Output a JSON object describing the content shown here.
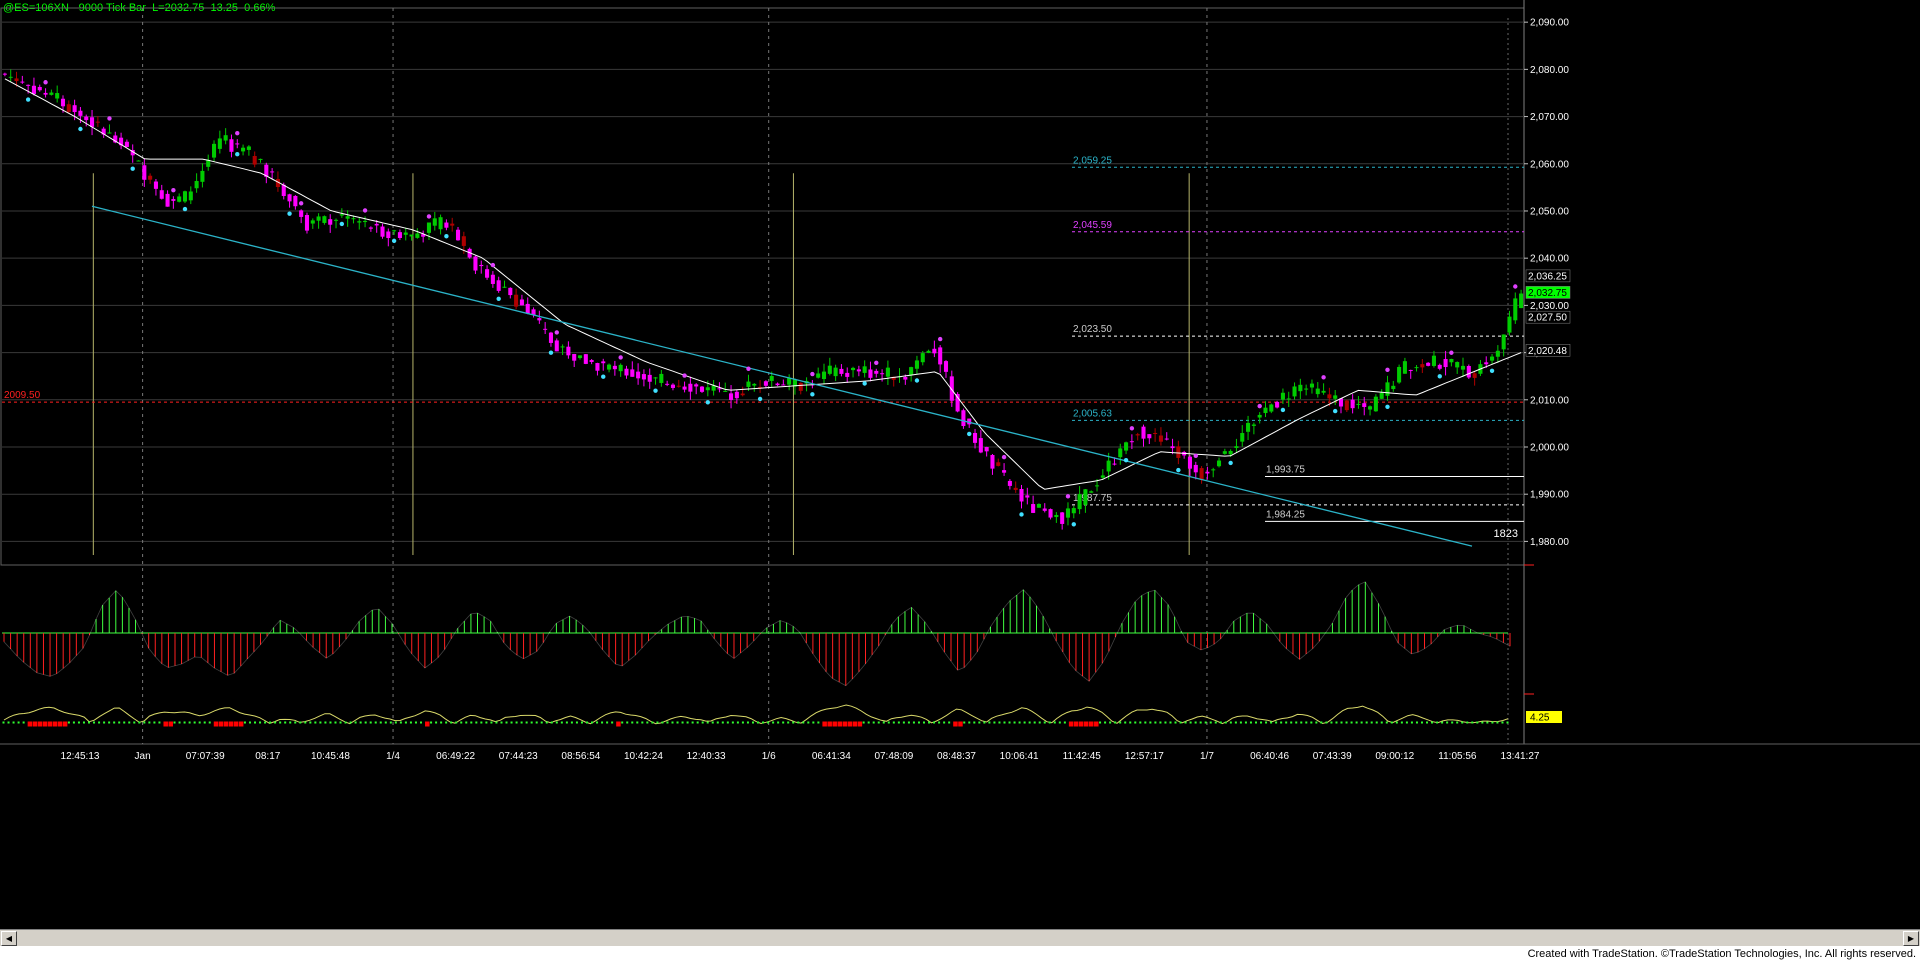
{
  "header": {
    "symbol": "@ES=106XN - 9000 Tick Bar",
    "last": "L=2032.75",
    "change": "13.25",
    "pct": "0.66%"
  },
  "footer_text": "Created with TradeStation. ©TradeStation Technologies, Inc. All rights reserved.",
  "colors": {
    "background": "#000000",
    "bull": "#00cc00",
    "bear": "#ff00ff",
    "bear_dark": "#b00000",
    "ma": "#ffffff",
    "trendline": "#2bb3c8",
    "cyan_dot": "#40e0ff",
    "magenta_dot": "#e040ff",
    "hist_up": "#40ff40",
    "hist_down": "#ff2020",
    "yellow": "#ffff00"
  },
  "chart_data": [
    {
      "type": "candlestick",
      "title": "@ES=106XN - 9000 Tick Bar",
      "ylim": [
        1975,
        2093
      ],
      "y_ticks": [
        "2,090.00",
        "2,080.00",
        "2,070.00",
        "2,060.00",
        "2,050.00",
        "2,040.00",
        "2,030.00",
        "2,020.00",
        "2,010.00",
        "2,000.00",
        "1,990.00",
        "1,980.00"
      ],
      "x_tick_labels": [
        "12:45:13",
        "Jan",
        "07:07:39",
        "08:17",
        "10:45:48",
        "1/4",
        "06:49:22",
        "07:44:23",
        "08:56:54",
        "10:42:24",
        "12:40:33",
        "1/6",
        "06:41:34",
        "07:48:09",
        "08:48:37",
        "10:06:41",
        "11:42:45",
        "12:57:17",
        "1/7",
        "06:40:46",
        "07:43:39",
        "09:00:12",
        "11:05:56",
        "13:41:27"
      ],
      "price_path": [
        [
          0,
          2079
        ],
        [
          10,
          2073
        ],
        [
          20,
          2064
        ],
        [
          28,
          2052
        ],
        [
          31,
          2053
        ],
        [
          37,
          2065
        ],
        [
          42,
          2062
        ],
        [
          48,
          2054
        ],
        [
          52,
          2047
        ],
        [
          58,
          2049
        ],
        [
          64,
          2046
        ],
        [
          70,
          2045
        ],
        [
          76,
          2048
        ],
        [
          81,
          2038
        ],
        [
          88,
          2031
        ],
        [
          94,
          2022
        ],
        [
          100,
          2018
        ],
        [
          106,
          2016
        ],
        [
          112,
          2014
        ],
        [
          118,
          2013
        ],
        [
          124,
          2011
        ],
        [
          130,
          2014
        ],
        [
          136,
          2013
        ],
        [
          142,
          2016
        ],
        [
          148,
          2016
        ],
        [
          154,
          2015
        ],
        [
          159,
          2022
        ],
        [
          164,
          2006
        ],
        [
          170,
          1995
        ],
        [
          176,
          1987
        ],
        [
          182,
          1985
        ],
        [
          188,
          1994
        ],
        [
          194,
          2004
        ],
        [
          200,
          2000
        ],
        [
          205,
          1994
        ],
        [
          210,
          2000
        ],
        [
          216,
          2008
        ],
        [
          222,
          2013
        ],
        [
          228,
          2010
        ],
        [
          234,
          2008
        ],
        [
          240,
          2017
        ],
        [
          246,
          2018
        ],
        [
          252,
          2016
        ],
        [
          256,
          2021
        ],
        [
          260,
          2033
        ]
      ],
      "moving_average": [
        [
          0,
          2078
        ],
        [
          12,
          2070
        ],
        [
          24,
          2061
        ],
        [
          34,
          2061
        ],
        [
          44,
          2058
        ],
        [
          56,
          2050
        ],
        [
          70,
          2046
        ],
        [
          82,
          2040
        ],
        [
          96,
          2026
        ],
        [
          110,
          2018
        ],
        [
          124,
          2012
        ],
        [
          136,
          2013
        ],
        [
          148,
          2014
        ],
        [
          160,
          2016
        ],
        [
          168,
          2003
        ],
        [
          178,
          1991
        ],
        [
          188,
          1993
        ],
        [
          198,
          1999
        ],
        [
          210,
          1998
        ],
        [
          222,
          2006
        ],
        [
          232,
          2012
        ],
        [
          242,
          2011
        ],
        [
          252,
          2016
        ],
        [
          260,
          2020
        ]
      ],
      "price_lines": [
        {
          "label": "2,059.25",
          "value": 2059.25,
          "color": "#2bb3c8",
          "style": "dash"
        },
        {
          "label": "2,045.59",
          "value": 2045.59,
          "color": "#e040ff",
          "style": "dash"
        },
        {
          "label": "2,023.50",
          "value": 2023.5,
          "color": "#ffffff",
          "style": "dash"
        },
        {
          "label": "2009.50",
          "value": 2009.5,
          "color": "#ff2020",
          "style": "dash"
        },
        {
          "label": "2,005.63",
          "value": 2005.63,
          "color": "#2bb3c8",
          "style": "dash"
        },
        {
          "label": "1,993.75",
          "value": 1993.75,
          "color": "#ffffff",
          "style": "solid"
        },
        {
          "label": "1,987.75",
          "value": 1987.75,
          "color": "#ffffff",
          "style": "dash"
        },
        {
          "label": "1,984.25",
          "value": 1984.25,
          "color": "#ffffff",
          "style": "solid"
        }
      ],
      "right_labels": [
        {
          "text": "2,036.25",
          "value": 2036.25,
          "bg": "#000000",
          "fg": "#ffffff",
          "box": true
        },
        {
          "text": "2,032.75",
          "value": 2032.75,
          "bg": "#00ff00",
          "fg": "#000000",
          "box": true
        },
        {
          "text": "2,027.50",
          "value": 2027.5,
          "bg": "#000000",
          "fg": "#ffffff",
          "box": true
        },
        {
          "text": "2,020.48",
          "value": 2020.48,
          "bg": "#000000",
          "fg": "#ffffff",
          "box": true
        }
      ],
      "annotation": "1823",
      "trendline": [
        [
          0,
          2051
        ],
        [
          270,
          1979
        ]
      ]
    },
    {
      "type": "histogram",
      "name": "oscillator",
      "values": [
        -2,
        -6,
        -9,
        -10,
        -7,
        -3,
        6,
        10,
        4,
        -4,
        -8,
        -7,
        -5,
        -8,
        -10,
        -6,
        -2,
        3,
        1,
        -3,
        -6,
        -2,
        3,
        6,
        2,
        -4,
        -8,
        -5,
        1,
        5,
        3,
        -3,
        -6,
        -4,
        2,
        4,
        1,
        -4,
        -8,
        -5,
        -1,
        2,
        4,
        3,
        -2,
        -6,
        -3,
        1,
        3,
        1,
        -5,
        -10,
        -12,
        -8,
        -3,
        3,
        6,
        2,
        -4,
        -9,
        -5,
        2,
        7,
        10,
        5,
        -2,
        -8,
        -11,
        -6,
        2,
        8,
        10,
        6,
        -2,
        -4,
        -2,
        3,
        5,
        2,
        -3,
        -6,
        -3,
        2,
        9,
        12,
        6,
        -2,
        -5,
        -3,
        1,
        2,
        0,
        -1,
        -3
      ]
    },
    {
      "type": "line",
      "name": "lower indicator",
      "value_label": "4.25"
    }
  ]
}
